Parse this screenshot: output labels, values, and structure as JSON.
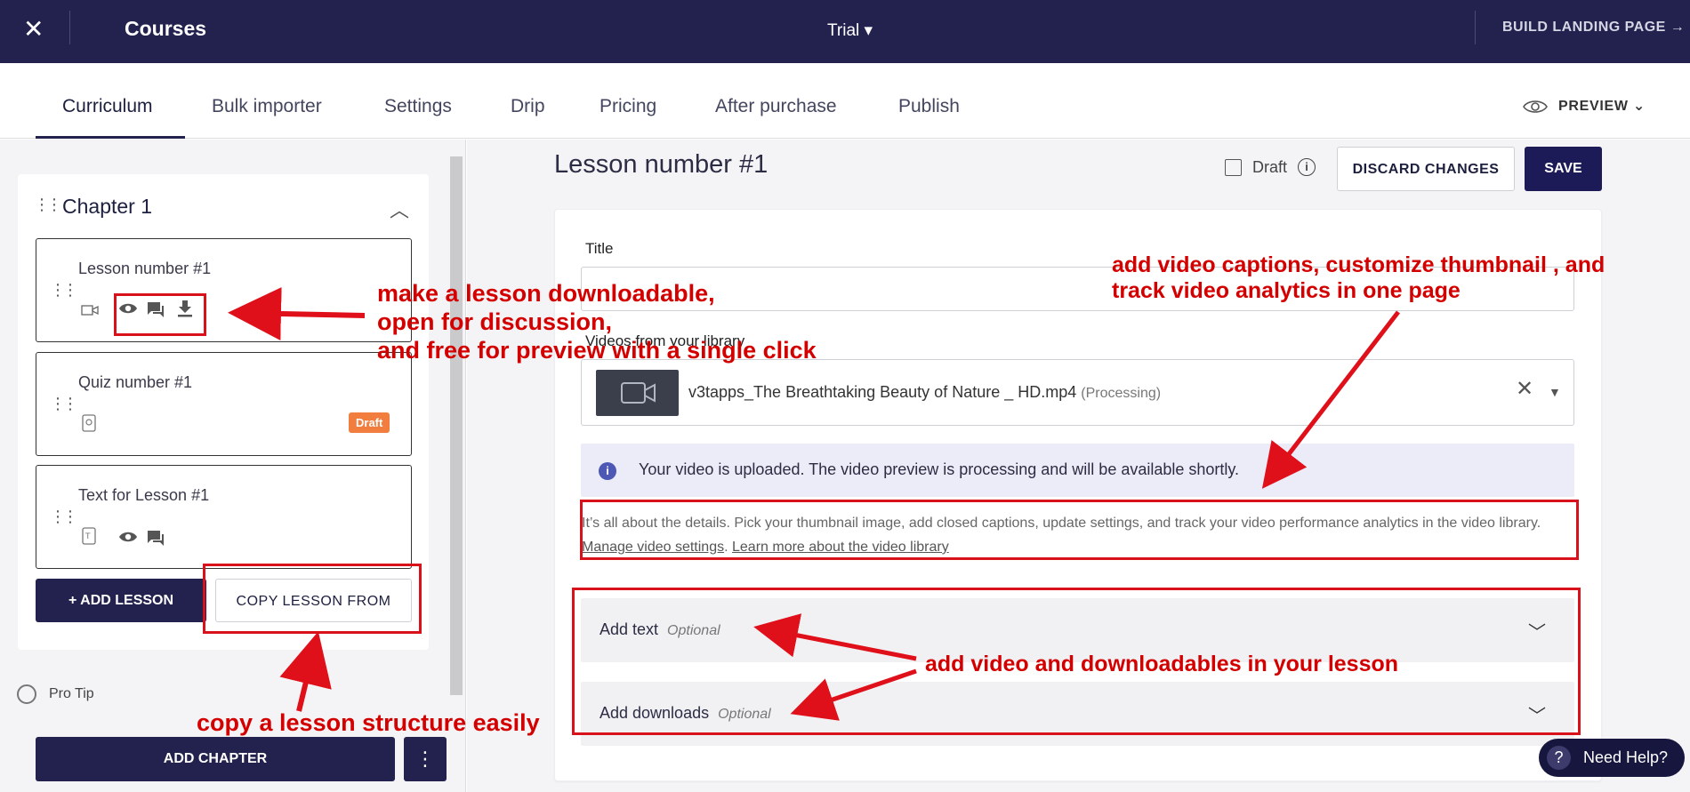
{
  "topbar": {
    "close": "✕",
    "title": "Courses",
    "trial": "Trial ▾",
    "build": "BUILD LANDING PAGE →"
  },
  "tabs": [
    "Curriculum",
    "Bulk importer",
    "Settings",
    "Drip",
    "Pricing",
    "After purchase",
    "Publish"
  ],
  "preview": {
    "label": "PREVIEW ⌄"
  },
  "sidebar": {
    "chapter": "Chapter 1",
    "lessons": [
      {
        "name": "Lesson number #1"
      },
      {
        "name": "Quiz number #1",
        "badge": "Draft"
      },
      {
        "name": "Text for Lesson #1"
      }
    ],
    "add_lesson": "+ ADD LESSON",
    "copy_lesson": "COPY LESSON FROM",
    "pro_tip": "Pro Tip",
    "add_chapter": "ADD CHAPTER",
    "more": "⋮"
  },
  "main": {
    "lesson_title": "Lesson number #1",
    "draft_label": "Draft",
    "discard": "DISCARD CHANGES",
    "save": "SAVE",
    "title_label": "Title",
    "video_label": "Videos from your library",
    "video_name": "v3tapps_The Breathtaking Beauty of Nature _ HD.mp4",
    "video_status": "(Processing)",
    "notice": "Your video is uploaded. The video preview is processing and will be available shortly.",
    "details": "It’s all about the details. Pick your thumbnail image, add closed captions, update settings, and track your video performance analytics in the video library.",
    "link1": "Manage video settings",
    "link2": "Learn more about the video library",
    "add_text": "Add text",
    "add_downloads": "Add downloads",
    "optional": "Optional"
  },
  "help": "Need Help?",
  "annotations": {
    "a1": "make a lesson downloadable,\nopen for discussion,\nand free for preview with a single click",
    "a2": "add video captions, customize thumbnail , and\ntrack video analytics in one page",
    "a3": "add video and downloadables in your lesson",
    "a4": "copy a lesson structure easily"
  }
}
